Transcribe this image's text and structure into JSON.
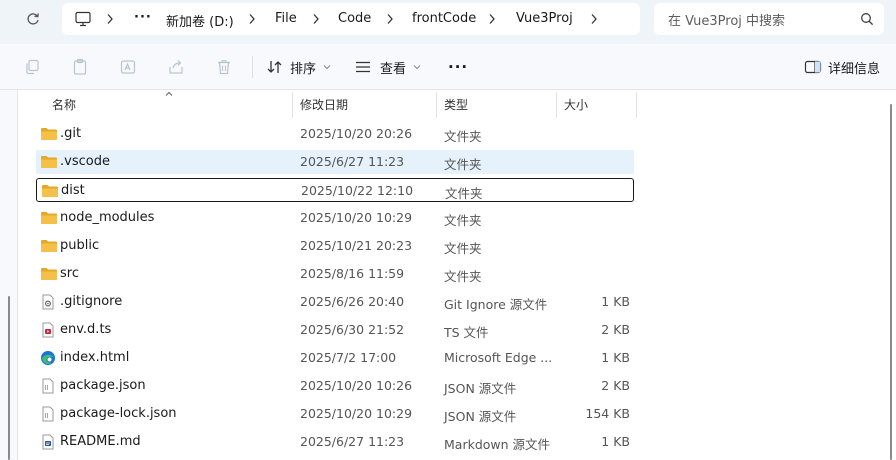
{
  "address": {
    "more": "···",
    "crumbs": [
      "新加卷 (D:)",
      "File",
      "Code",
      "frontCode",
      "Vue3Proj"
    ]
  },
  "search": {
    "placeholder": "在 Vue3Proj 中搜索"
  },
  "toolbar": {
    "sort_label": "排序",
    "view_label": "查看",
    "more_label": "···",
    "details_label": "详细信息"
  },
  "columns": {
    "name": "名称",
    "date": "修改日期",
    "type": "类型",
    "size": "大小"
  },
  "files": [
    {
      "name": ".git",
      "date": "2025/10/20 20:26",
      "type": "文件夹",
      "size": "",
      "icon": "folder-icon"
    },
    {
      "name": ".vscode",
      "date": "2025/6/27 11:23",
      "type": "文件夹",
      "size": "",
      "icon": "folder-icon"
    },
    {
      "name": "dist",
      "date": "2025/10/22 12:10",
      "type": "文件夹",
      "size": "",
      "icon": "folder-icon"
    },
    {
      "name": "node_modules",
      "date": "2025/10/20 10:29",
      "type": "文件夹",
      "size": "",
      "icon": "folder-icon"
    },
    {
      "name": "public",
      "date": "2025/10/21 20:23",
      "type": "文件夹",
      "size": "",
      "icon": "folder-icon"
    },
    {
      "name": "src",
      "date": "2025/8/16 11:59",
      "type": "文件夹",
      "size": "",
      "icon": "folder-icon"
    },
    {
      "name": ".gitignore",
      "date": "2025/6/26 20:40",
      "type": "Git Ignore 源文件",
      "size": "1 KB",
      "icon": "gear-file-icon"
    },
    {
      "name": "env.d.ts",
      "date": "2025/6/30 21:52",
      "type": "TS 文件",
      "size": "2 KB",
      "icon": "media-file-icon"
    },
    {
      "name": "index.html",
      "date": "2025/7/2 17:00",
      "type": "Microsoft Edge ...",
      "size": "1 KB",
      "icon": "edge-icon"
    },
    {
      "name": "package.json",
      "date": "2025/10/20 10:26",
      "type": "JSON 源文件",
      "size": "2 KB",
      "icon": "text-file-icon"
    },
    {
      "name": "package-lock.json",
      "date": "2025/10/20 10:29",
      "type": "JSON 源文件",
      "size": "154 KB",
      "icon": "text-file-icon"
    },
    {
      "name": "README.md",
      "date": "2025/6/27 11:23",
      "type": "Markdown 源文件",
      "size": "1 KB",
      "icon": "document-file-icon"
    }
  ],
  "states": {
    "hover_row": 1,
    "focus_row": 2
  },
  "colors": {
    "folder": "#f5c04a",
    "folder_dark": "#e3a92b",
    "hover": "#e5f1fb",
    "edge_blue": "#1a73d9",
    "edge_green": "#3fbf6f"
  }
}
